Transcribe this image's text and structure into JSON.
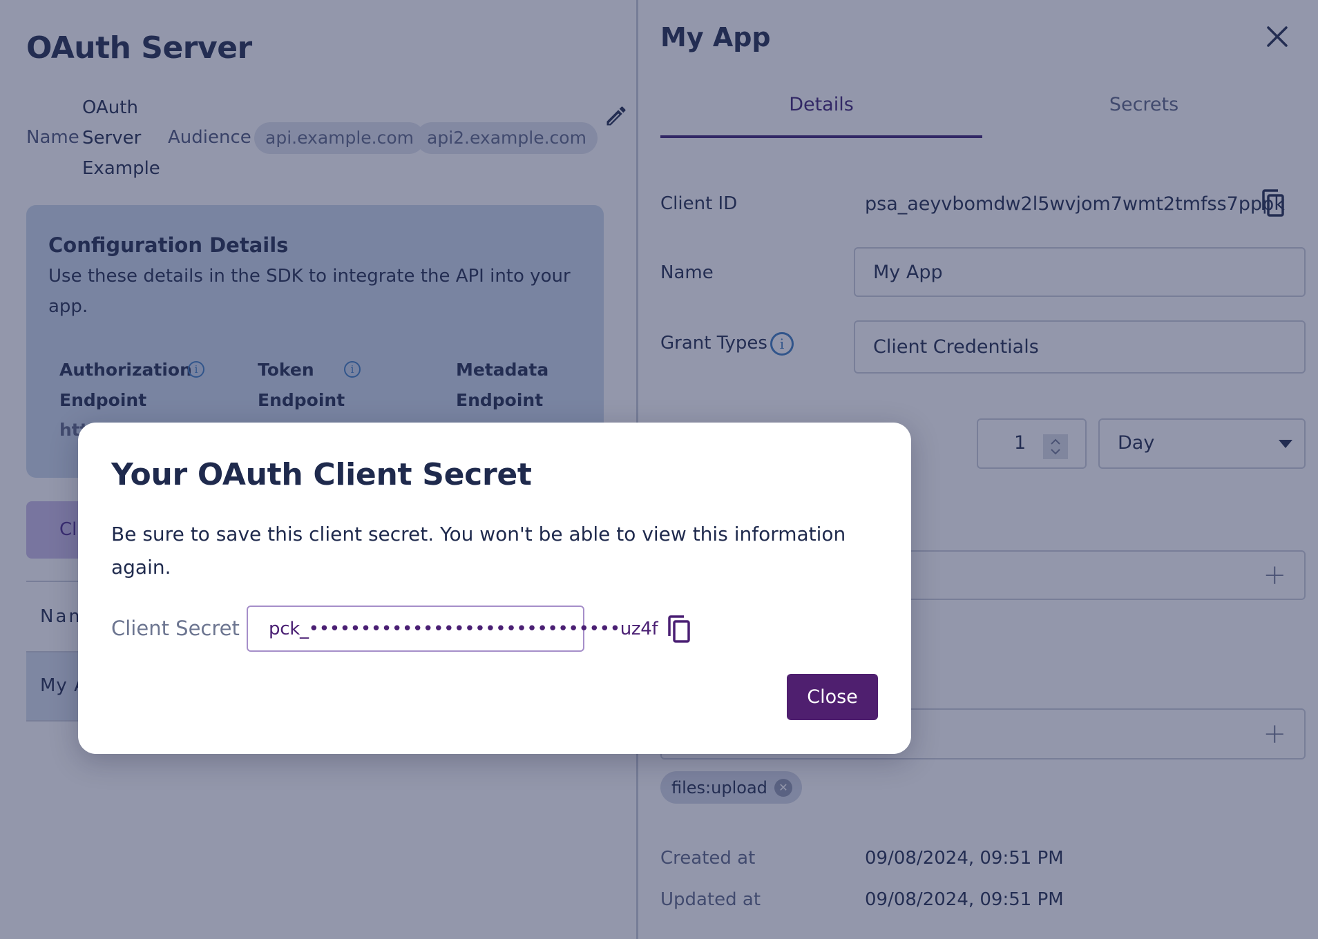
{
  "server": {
    "title": "OAuth Server",
    "name_label": "Name",
    "name_lines": [
      "OAuth",
      "Server",
      "Example"
    ],
    "audience_label": "Audience",
    "audience": [
      "api.example.com",
      "api2.example.com"
    ],
    "config": {
      "title": "Configuration Details",
      "description": "Use these details in the SDK to integrate the API into your app.",
      "columns": [
        {
          "line1": "Authorization",
          "line2": "Endpoint",
          "info": true
        },
        {
          "line1": "Token",
          "line2": "Endpoint",
          "info": true
        },
        {
          "line1": "Metadata",
          "line2": "Endpoint",
          "info": false
        }
      ],
      "partial_value": "htt"
    },
    "clients_tab": "Clients",
    "table_header": "Name",
    "table_row": "My App"
  },
  "client_panel": {
    "title": "My App",
    "tabs": [
      {
        "label": "Details",
        "active": true
      },
      {
        "label": "Secrets",
        "active": false
      }
    ],
    "client_id_label": "Client ID",
    "client_id": "psa_aeyvbomdw2l5wvjom7wmt2tmfss7pppk",
    "name_label": "Name",
    "name_value": "My App",
    "grant_types_label": "Grant Types",
    "grant_types_value": "Client Credentials",
    "expiry_amount": "1",
    "expiry_unit": "Day",
    "scopes": [
      "files:upload"
    ],
    "created_label": "Created at",
    "created_value": "09/08/2024, 09:51 PM",
    "updated_label": "Updated at",
    "updated_value": "09/08/2024, 09:51 PM"
  },
  "modal": {
    "title": "Your OAuth Client Secret",
    "body": "Be sure to save this client secret. You won't be able to view this information again.",
    "secret_label": "Client Secret",
    "secret_value": "pck_••••••••••••••••••••••••••••••uz4f",
    "close_label": "Close"
  },
  "colors": {
    "primary": "#4f1f6f",
    "text": "#1f2a4d",
    "info": "#3b7bbf"
  }
}
